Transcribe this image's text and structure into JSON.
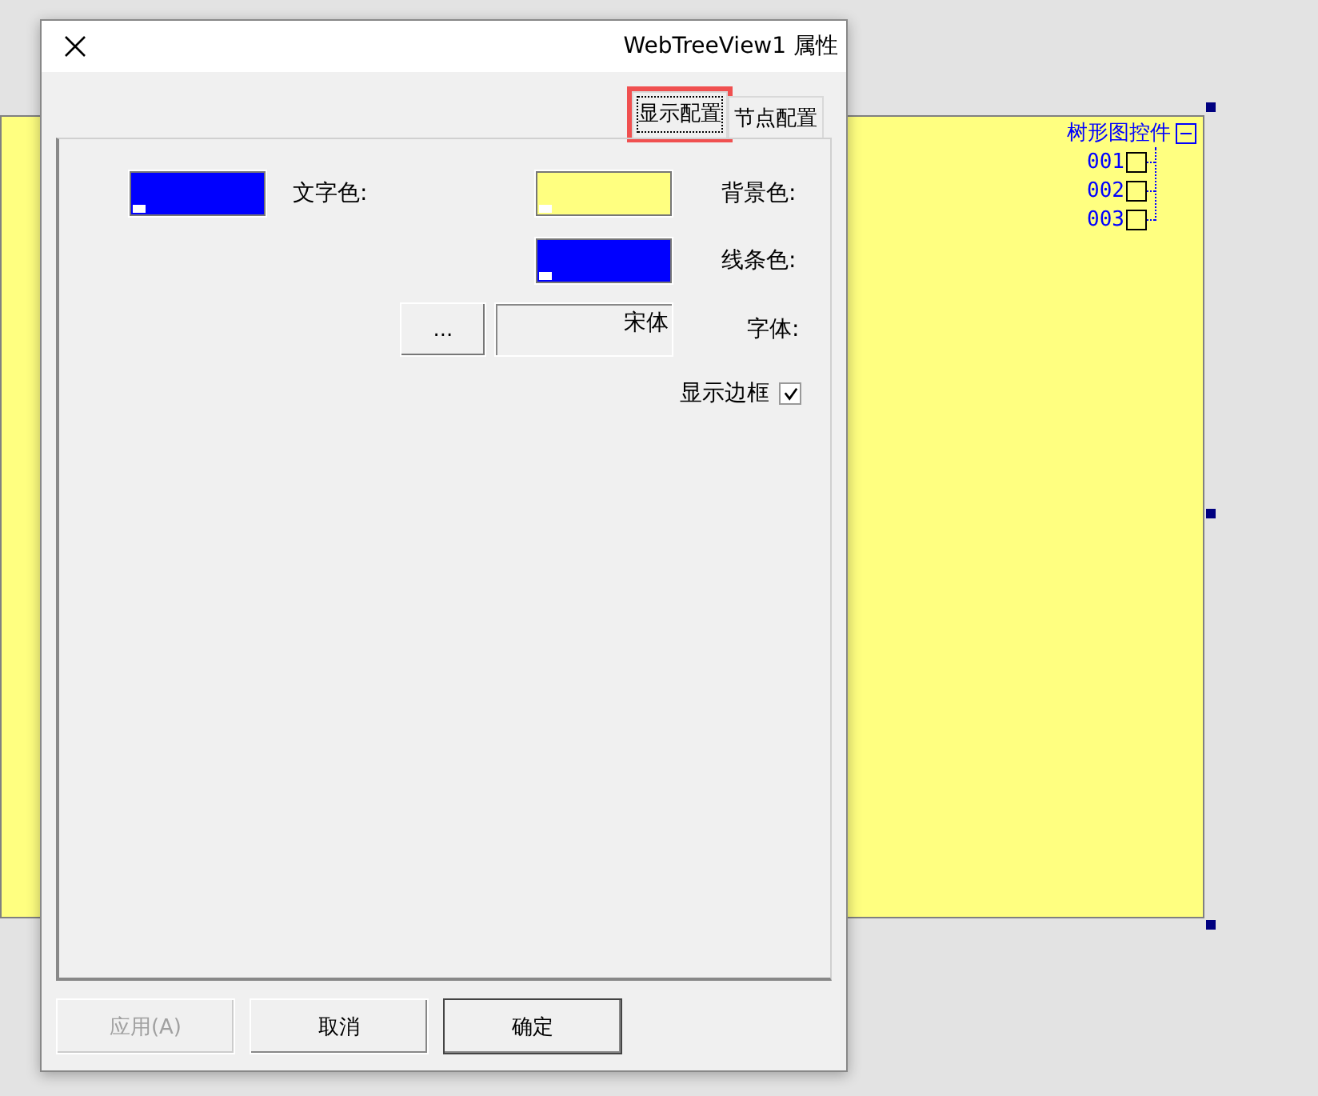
{
  "canvas": {
    "tree": {
      "label": "树形图控件",
      "expanded": true,
      "children": [
        {
          "label": "001"
        },
        {
          "label": "002"
        },
        {
          "label": "003"
        }
      ]
    }
  },
  "dialog": {
    "title": "WebTreeView1 属性",
    "tabs": [
      {
        "label": "显示配置",
        "selected": true
      },
      {
        "label": "节点配置",
        "selected": false
      }
    ],
    "colors": [
      {
        "label": "背景色:",
        "color": "#ffff80"
      },
      {
        "label": "文字色:",
        "color": "#0000ff"
      },
      {
        "label": "线条色:",
        "color": "#0000ff"
      }
    ],
    "font": {
      "label": "字体:",
      "value": "宋体",
      "button": "..."
    },
    "show_border": {
      "label": "显示边框",
      "checked": true
    },
    "buttons": [
      {
        "label": "应用(A)",
        "disabled": true,
        "default": false
      },
      {
        "label": "取消",
        "disabled": false,
        "default": false
      },
      {
        "label": "确定",
        "disabled": false,
        "default": true
      }
    ]
  }
}
